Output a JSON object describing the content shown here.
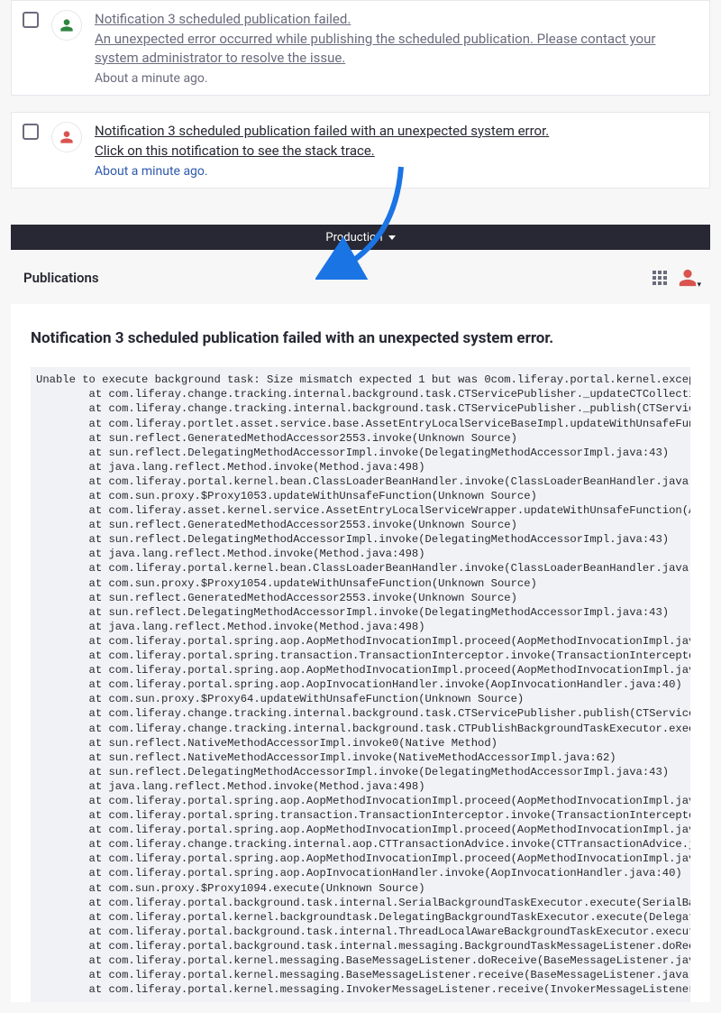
{
  "notif1": {
    "title": "Notification 3 scheduled publication failed.",
    "subtitle": "An unexpected error occurred while publishing the scheduled publication. Please contact your system administrator to resolve the issue.",
    "time": "About a minute ago."
  },
  "notif2": {
    "title": "Notification 3 scheduled publication failed with an unexpected system error.",
    "subtitle": "Click on this notification to see the stack trace.",
    "time": "About a minute ago."
  },
  "topbar": {
    "label": "Production"
  },
  "subheader": {
    "title": "Publications"
  },
  "detail": {
    "title": "Notification 3 scheduled publication failed with an unexpected system error.",
    "stacktrace": "Unable to execute background task: Size mismatch expected 1 but was 0com.liferay.portal.kernel.exception.SystemExcep\n        at com.liferay.change.tracking.internal.background.task.CTServicePublisher._updateCTCollectionId(CTServicePu\n        at com.liferay.change.tracking.internal.background.task.CTServicePublisher._publish(CTServicePublisher.java\n        at com.liferay.portlet.asset.service.base.AssetEntryLocalServiceBaseImpl.updateWithUnsafeFunction(AssetEntry\n        at sun.reflect.GeneratedMethodAccessor2553.invoke(Unknown Source)\n        at sun.reflect.DelegatingMethodAccessorImpl.invoke(DelegatingMethodAccessorImpl.java:43)\n        at java.lang.reflect.Method.invoke(Method.java:498)\n        at com.liferay.portal.kernel.bean.ClassLoaderBeanHandler.invoke(ClassLoaderBeanHandler.java:60)\n        at com.sun.proxy.$Proxy1053.updateWithUnsafeFunction(Unknown Source)\n        at com.liferay.asset.kernel.service.AssetEntryLocalServiceWrapper.updateWithUnsafeFunction(AssetEntryLocalSe\n        at sun.reflect.GeneratedMethodAccessor2553.invoke(Unknown Source)\n        at sun.reflect.DelegatingMethodAccessorImpl.invoke(DelegatingMethodAccessorImpl.java:43)\n        at java.lang.reflect.Method.invoke(Method.java:498)\n        at com.liferay.portal.kernel.bean.ClassLoaderBeanHandler.invoke(ClassLoaderBeanHandler.java:60)\n        at com.sun.proxy.$Proxy1054.updateWithUnsafeFunction(Unknown Source)\n        at sun.reflect.GeneratedMethodAccessor2553.invoke(Unknown Source)\n        at sun.reflect.DelegatingMethodAccessorImpl.invoke(DelegatingMethodAccessorImpl.java:43)\n        at java.lang.reflect.Method.invoke(Method.java:498)\n        at com.liferay.portal.spring.aop.AopMethodInvocationImpl.proceed(AopMethodInvocationImpl.java:41)\n        at com.liferay.portal.spring.transaction.TransactionInterceptor.invoke(TransactionInterceptor.java:60)\n        at com.liferay.portal.spring.aop.AopMethodInvocationImpl.proceed(AopMethodInvocationImpl.java:48)\n        at com.liferay.portal.spring.aop.AopInvocationHandler.invoke(AopInvocationHandler.java:40)\n        at com.sun.proxy.$Proxy64.updateWithUnsafeFunction(Unknown Source)\n        at com.liferay.change.tracking.internal.background.task.CTServicePublisher.publish(CTServicePublisher.java:\n        at com.liferay.change.tracking.internal.background.task.CTPublishBackgroundTaskExecutor.execute(CTPublishBa\n        at sun.reflect.NativeMethodAccessorImpl.invoke0(Native Method)\n        at sun.reflect.NativeMethodAccessorImpl.invoke(NativeMethodAccessorImpl.java:62)\n        at sun.reflect.DelegatingMethodAccessorImpl.invoke(DelegatingMethodAccessorImpl.java:43)\n        at java.lang.reflect.Method.invoke(Method.java:498)\n        at com.liferay.portal.spring.aop.AopMethodInvocationImpl.proceed(AopMethodInvocationImpl.java:41)\n        at com.liferay.portal.spring.transaction.TransactionInterceptor.invoke(TransactionInterceptor.java:60)\n        at com.liferay.portal.spring.aop.AopMethodInvocationImpl.proceed(AopMethodInvocationImpl.java:48)\n        at com.liferay.change.tracking.internal.aop.CTTransactionAdvice.invoke(CTTransactionAdvice.java:70)\n        at com.liferay.portal.spring.aop.AopMethodInvocationImpl.proceed(AopMethodInvocationImpl.java:48)\n        at com.liferay.portal.spring.aop.AopInvocationHandler.invoke(AopInvocationHandler.java:40)\n        at com.sun.proxy.$Proxy1094.execute(Unknown Source)\n        at com.liferay.portal.background.task.internal.SerialBackgroundTaskExecutor.execute(SerialBackgroundTaskExe\n        at com.liferay.portal.kernel.backgroundtask.DelegatingBackgroundTaskExecutor.execute(DelegatingBackgroundTas\n        at com.liferay.portal.background.task.internal.ThreadLocalAwareBackgroundTaskExecutor.execute(ThreadLocalAwa\n        at com.liferay.portal.background.task.internal.messaging.BackgroundTaskMessageListener.doReceive(Background\n        at com.liferay.portal.kernel.messaging.BaseMessageListener.doReceive(BaseMessageListener.java:39)\n        at com.liferay.portal.kernel.messaging.BaseMessageListener.receive(BaseMessageListener.java:25)\n        at com.liferay.portal.kernel.messaging.InvokerMessageListener.receive(InvokerMessageListener.java:62)"
  }
}
